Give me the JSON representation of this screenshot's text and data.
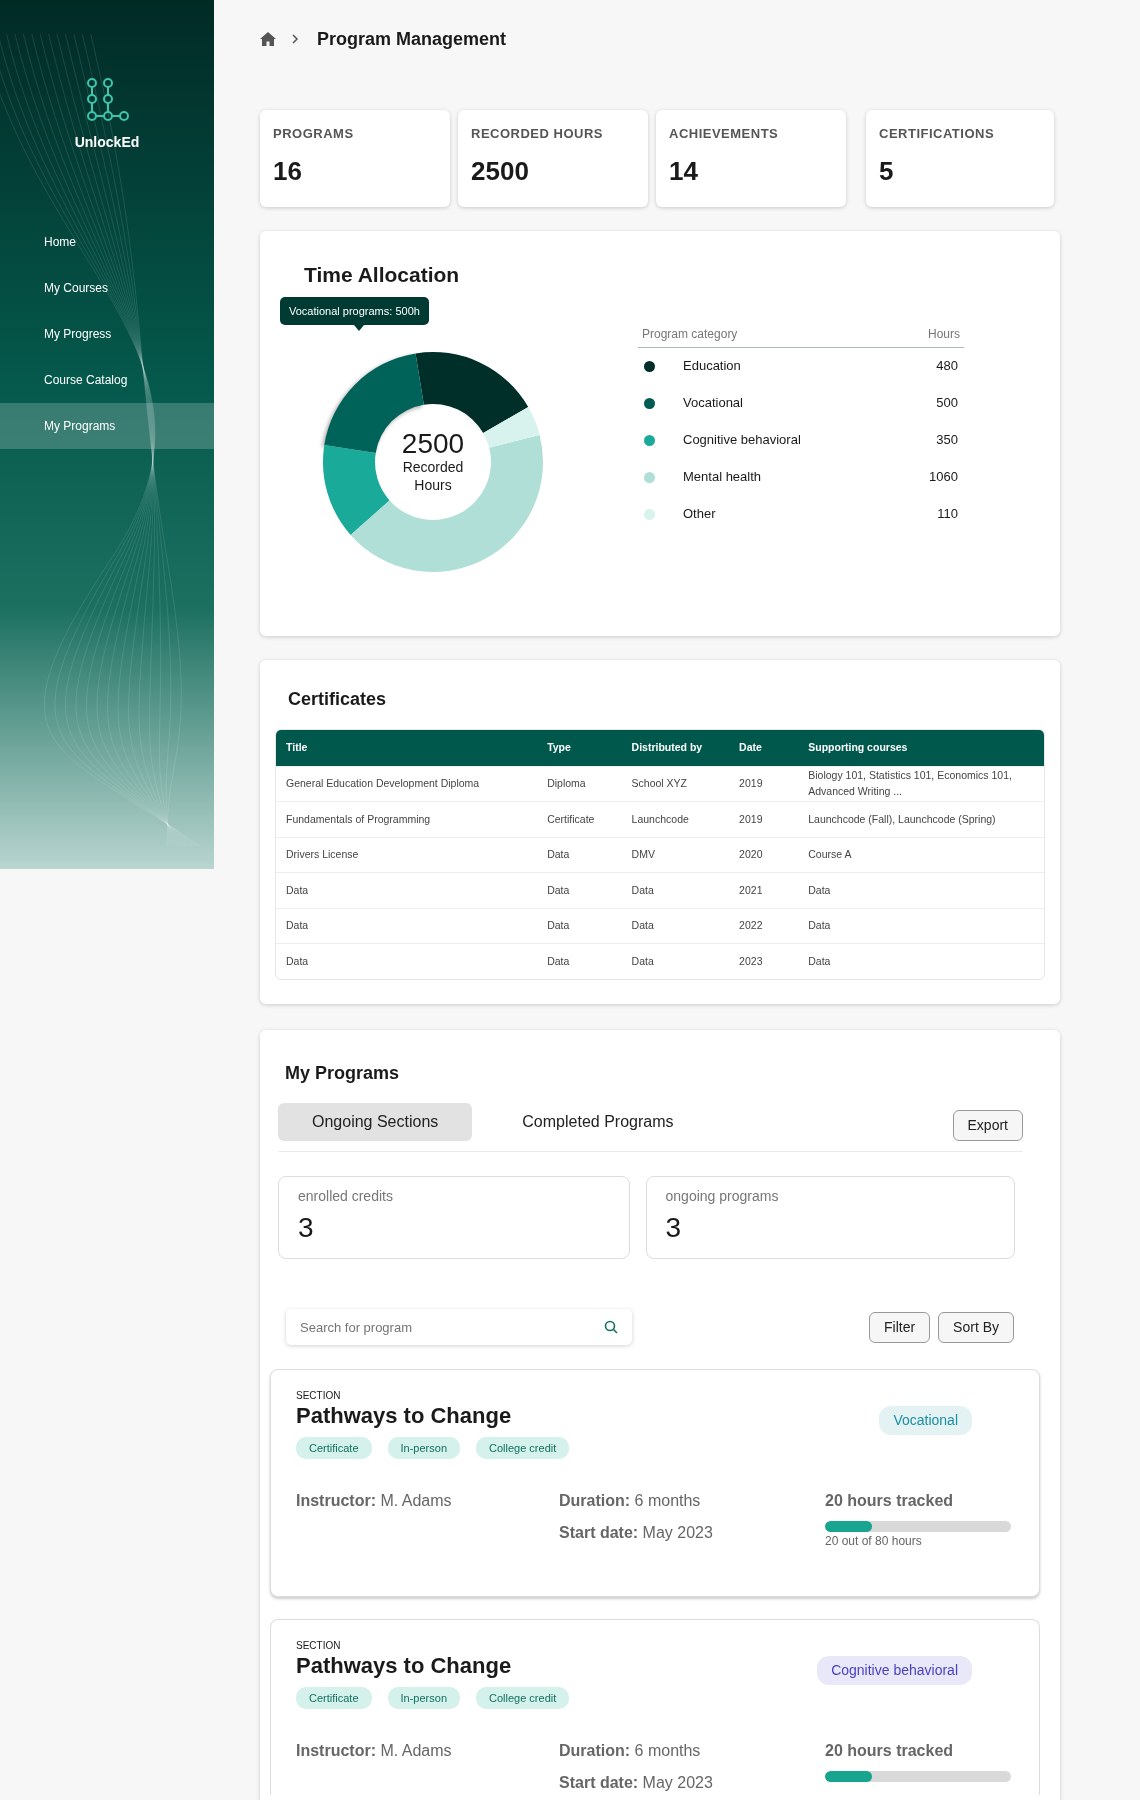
{
  "sidebar": {
    "brand": "UnlockEd",
    "items": [
      {
        "label": "Home",
        "selected": false
      },
      {
        "label": "My Courses",
        "selected": false
      },
      {
        "label": "My Progress",
        "selected": false
      },
      {
        "label": "Course Catalog",
        "selected": false
      },
      {
        "label": "My Programs",
        "selected": true
      }
    ]
  },
  "breadcrumb": {
    "current": "Program Management"
  },
  "stats": [
    {
      "label": "PROGRAMS",
      "value": "16"
    },
    {
      "label": "RECORDED HOURS",
      "value": "2500"
    },
    {
      "label": "ACHIEVEMENTS",
      "value": "14"
    },
    {
      "label": "CERTIFICATIONS",
      "value": "5"
    }
  ],
  "time_allocation": {
    "title": "Time Allocation",
    "tooltip": "Vocational programs: 500h",
    "center_value": "2500",
    "center_label": "Recorded Hours",
    "chart_data": {
      "type": "donut",
      "categories": [
        "Education",
        "Vocational",
        "Cognitive behavioral",
        "Mental health",
        "Other"
      ],
      "values": [
        19.2,
        20,
        14,
        42.4,
        4.4
      ]
    },
    "legend_header": {
      "category": "Program category",
      "hours": "Hours"
    },
    "legend": [
      {
        "hours": "480",
        "color": "#002e29",
        "highlighted": false
      },
      {
        "hours": "500",
        "color": "#005c52",
        "highlighted": true
      },
      {
        "hours": "350",
        "color": "#1aaa9a",
        "highlighted": false
      },
      {
        "hours": "1060",
        "color": "#b0dfd8",
        "highlighted": false
      },
      {
        "hours": "110",
        "color": "#d8f2ee",
        "highlighted": false
      }
    ]
  },
  "certificates": {
    "title": "Certificates",
    "columns": [
      "Title",
      "Type",
      "Distributed by",
      "Date",
      "Supporting courses"
    ],
    "rows": [
      [
        "General Education Development Diploma",
        "Diploma",
        "School XYZ",
        "2019",
        "Biology 101, Statistics 101, Economics 101, Advanced Writing ..."
      ],
      [
        "Fundamentals of Programming",
        "Certificate",
        "Launchcode",
        "2019",
        "Launchcode (Fall), Launchcode (Spring)"
      ],
      [
        "Drivers License",
        "Data",
        "DMV",
        "2020",
        "Course A"
      ],
      [
        "Data",
        "Data",
        "Data",
        "2021",
        "Data"
      ],
      [
        "Data",
        "Data",
        "Data",
        "2022",
        "Data"
      ],
      [
        "Data",
        "Data",
        "Data",
        "2023",
        "Data"
      ]
    ]
  },
  "my_programs": {
    "title": "My Programs",
    "tabs": [
      {
        "label": "Ongoing Sections",
        "selected": true
      },
      {
        "label": "Completed Programs",
        "selected": false
      }
    ],
    "export_button": "Export",
    "summary": [
      {
        "label": "enrolled credits",
        "value": "3"
      },
      {
        "label": "ongoing programs",
        "value": "3"
      }
    ],
    "search": {
      "placeholder": "Search for program"
    },
    "filter_button": "Filter",
    "sort_button": "Sort By",
    "programs": [
      {
        "eyebrow": "SECTION",
        "title": "Pathways to Change",
        "category": {
          "text": "Vocational",
          "color": "#1a8fa0"
        },
        "tags": [
          "Certificate",
          "In-person",
          "College credit"
        ],
        "instructor_label": "Instructor:",
        "instructor": "M. Adams",
        "duration_label": "Duration:",
        "duration": "6 months",
        "start_label": "Start date:",
        "start": "May 2023",
        "tracked": "20 hours tracked",
        "level": 0.25,
        "progress_caption": "20 out of 80 hours"
      },
      {
        "eyebrow": "SECTION",
        "title": "Pathways to Change",
        "category": {
          "text": "Cognitive behavioral",
          "color": "#4a3fc4"
        },
        "tags": [
          "Certificate",
          "In-person",
          "College credit"
        ],
        "instructor_label": "Instructor:",
        "instructor": "M. Adams",
        "duration_label": "Duration:",
        "duration": "6 months",
        "start_label": "Start date:",
        "start": "May 2023",
        "tracked": "20 hours tracked",
        "level": 0.25
      }
    ]
  }
}
